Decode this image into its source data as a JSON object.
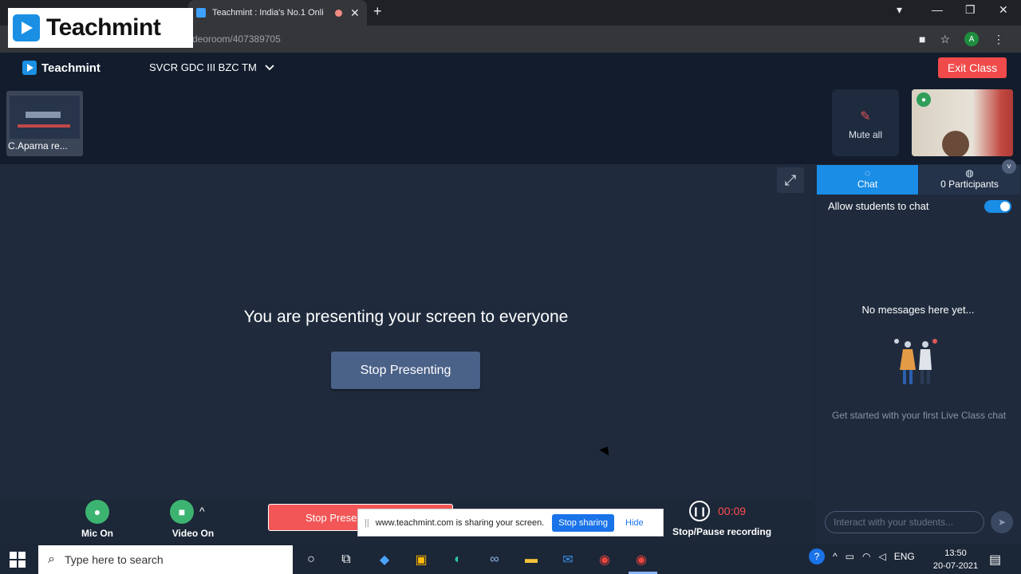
{
  "browser": {
    "tab_title": "Teachmint : India's No.1 Onli",
    "url": "deoroom/407389705",
    "profile_initial": "A"
  },
  "overlay_logo": {
    "text": "Teachmint"
  },
  "app": {
    "logo_text": "Teachmint",
    "class_name": "SVCR GDC III BZC TM",
    "exit_label": "Exit Class"
  },
  "thumbnails": {
    "self_label": "C.Aparna re...",
    "mute_all_label": "Mute all"
  },
  "stage": {
    "message": "You are presenting your screen to everyone",
    "stop_presenting_label": "Stop Presenting"
  },
  "side_panel": {
    "tabs": [
      {
        "label": "Chat",
        "active": true
      },
      {
        "label": "0 Participants",
        "active": false
      }
    ],
    "allow_chat_label": "Allow students to chat",
    "allow_chat_enabled": true,
    "empty_title": "No messages here yet...",
    "empty_hint": "Get started with your first Live Class chat",
    "input_placeholder": "Interact with your students..."
  },
  "controls": {
    "mic_label": "Mic On",
    "video_label": "Video On",
    "stop_present_label": "Stop Prese",
    "recording_timer": "00:09",
    "recording_label": "Stop/Pause recording"
  },
  "share_bar": {
    "message": "www.teachmint.com is sharing your screen.",
    "stop_label": "Stop sharing",
    "hide_label": "Hide"
  },
  "taskbar": {
    "search_placeholder": "Type here to search",
    "language": "ENG",
    "time": "13:50",
    "date": "20-07-2021"
  },
  "colors": {
    "accent": "#1a8de6",
    "exit_red": "#f04a4a",
    "mic_green": "#3cb371",
    "timer_red": "#ff4d4d"
  }
}
